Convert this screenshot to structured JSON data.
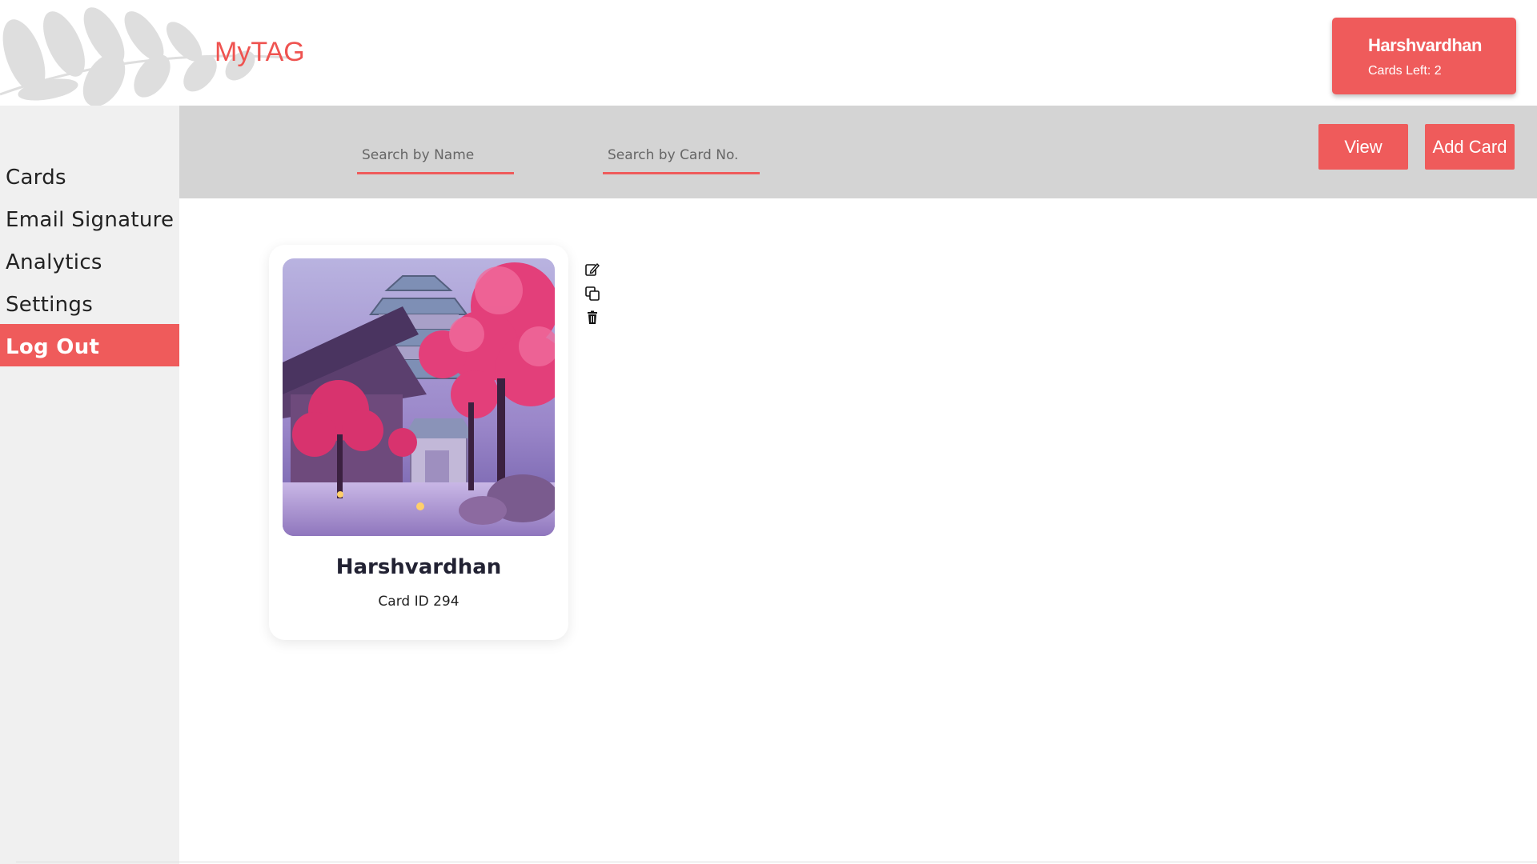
{
  "header": {
    "brand": "MyTAG",
    "user": {
      "name": "Harshvardhan",
      "cards_left": "Cards Left: 2"
    }
  },
  "sidebar": {
    "items": [
      {
        "label": "Cards"
      },
      {
        "label": "Email Signature"
      },
      {
        "label": "Analytics"
      },
      {
        "label": "Settings"
      },
      {
        "label": "Log Out",
        "active": true
      }
    ]
  },
  "toolbar": {
    "search_name_placeholder": "Search by Name",
    "search_card_placeholder": "Search by Card No.",
    "view_label": "View",
    "add_label": "Add Card"
  },
  "cards": [
    {
      "name": "Harshvardhan",
      "card_id": "Card ID 294",
      "image": "pagoda-cherry-blossom-scene"
    }
  ],
  "icons": [
    "edit-icon",
    "copy-icon",
    "trash-icon"
  ],
  "colors": {
    "accent": "#ef5b5b",
    "toolbar": "#d4d4d4",
    "sidebar": "#f0f0f0"
  }
}
